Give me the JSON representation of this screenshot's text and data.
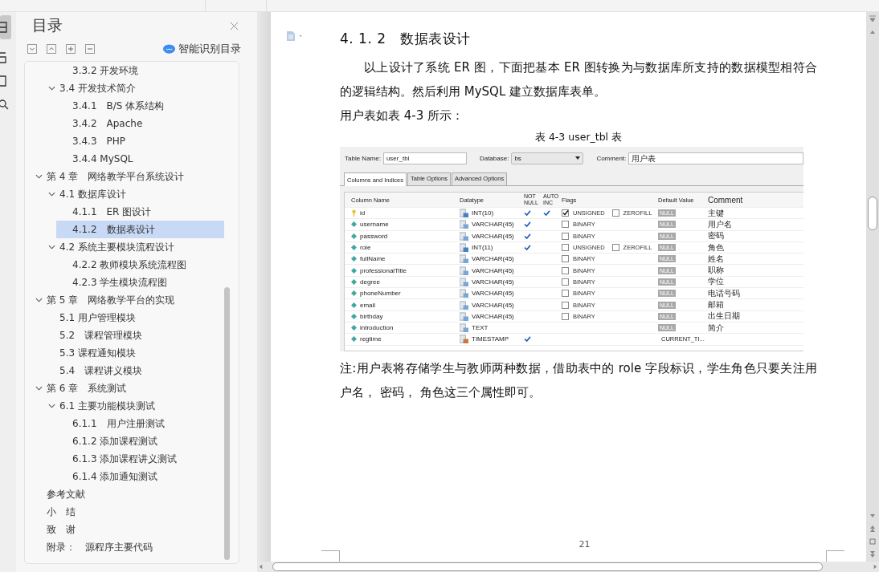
{
  "toc": {
    "title": "目录",
    "smart_button": "智能识别目录",
    "items": [
      {
        "children": [
          {
            "children": [
              {
                "label": "3.3.2 开发环境",
                "selected": false
              }
            ]
          },
          {
            "label": "3.4 开发技术简介",
            "expanded": true,
            "selected": false,
            "children": [
              {
                "label": "3.4.1　B/S 体系结构",
                "selected": false
              },
              {
                "label": "3.4.2　Apache",
                "selected": false
              },
              {
                "label": "3.4.3　PHP",
                "selected": false
              },
              {
                "label": "3.4.4 MySQL",
                "selected": false
              }
            ]
          }
        ]
      },
      {
        "label": "第 4 章　网络教学平台系统设计",
        "expanded": true,
        "selected": false,
        "children": [
          {
            "label": "4.1 数据库设计",
            "expanded": true,
            "selected": false,
            "children": [
              {
                "label": "4.1.1　ER 图设计",
                "selected": false
              },
              {
                "label": "4.1.2　数据表设计",
                "selected": true
              }
            ]
          },
          {
            "label": "4.2 系统主要模块流程设计",
            "expanded": true,
            "selected": false,
            "children": [
              {
                "label": "4.2.2 教师模块系统流程图",
                "selected": false
              },
              {
                "label": "4.2.3 学生模块流程图",
                "selected": false
              }
            ]
          }
        ]
      },
      {
        "label": "第 5 章　网络教学平台的实现",
        "expanded": true,
        "selected": false,
        "children": [
          {
            "label": "5.1 用户管理模块",
            "selected": false
          },
          {
            "label": "5.2　课程管理模块",
            "selected": false
          },
          {
            "label": "5.3 课程通知模块",
            "selected": false
          },
          {
            "label": "5.4　课程讲义模块",
            "selected": false
          }
        ]
      },
      {
        "label": "第 6 章　系统测试",
        "expanded": true,
        "selected": false,
        "children": [
          {
            "label": "6.1 主要功能模块测试",
            "expanded": true,
            "selected": false,
            "children": [
              {
                "label": "6.1.1　用户注册测试",
                "selected": false
              },
              {
                "label": "6.1.2 添加课程测试",
                "selected": false
              },
              {
                "label": "6.1.3 添加课程讲义测试",
                "selected": false
              },
              {
                "label": "6.1.4 添加通知测试",
                "selected": false
              }
            ]
          }
        ]
      },
      {
        "label": "参考文献",
        "selected": false
      },
      {
        "label": "小　结",
        "selected": false
      },
      {
        "label": "致　谢",
        "selected": false
      },
      {
        "label": "附录：　源程序主要代码",
        "selected": false
      }
    ]
  },
  "document": {
    "heading": "4. 1. 2　数据表设计",
    "paragraph": "以上设计了系统 ER 图，下面把基本 ER 图转换为与数据库所支持的数据模型相符合的逻辑结构。然后利用 MySQL 建立数据库表单。",
    "intro": "用户表如表 4-3 所示：",
    "caption": "表 4-3 user_tbl 表",
    "note": "注:用户表将存储学生与教师两种数据，借助表中的 role 字段标识，学生角色只要关注用户名， 密码， 角色这三个属性即可。",
    "page_number": "21"
  },
  "table_editor": {
    "table_name_label": "Table Name:",
    "table_name": "user_tbl",
    "database_label": "Database:",
    "database": "bs",
    "comment_label": "Comment:",
    "comment": "用户表",
    "tabs": [
      {
        "label": "Columns and Indices",
        "selected": true
      },
      {
        "label": "Table Options",
        "selected": false
      },
      {
        "label": "Advanced Options",
        "selected": false
      }
    ],
    "columns": [
      "Column Name",
      "Datatype",
      "NOT NULL",
      "AUTO INC",
      "Flags",
      "Default Value",
      "Comment"
    ],
    "rows": [
      {
        "name": "id",
        "primary_key": true,
        "datatype": "INT(10)",
        "kind": "int",
        "not_null": true,
        "auto_inc": true,
        "flags": [
          {
            "label": "UNSIGNED",
            "checked": true
          },
          {
            "label": "ZEROFILL",
            "checked": false
          }
        ],
        "default": "NULL",
        "comment": "主键"
      },
      {
        "name": "username",
        "primary_key": false,
        "datatype": "VARCHAR(45)",
        "kind": "varchar",
        "not_null": true,
        "auto_inc": false,
        "flags": [
          {
            "label": "BINARY",
            "checked": false
          }
        ],
        "default": "NULL",
        "comment": "用户名"
      },
      {
        "name": "password",
        "primary_key": false,
        "datatype": "VARCHAR(45)",
        "kind": "varchar",
        "not_null": true,
        "auto_inc": false,
        "flags": [
          {
            "label": "BINARY",
            "checked": false
          }
        ],
        "default": "NULL",
        "comment": "密码"
      },
      {
        "name": "role",
        "primary_key": false,
        "datatype": "INT(11)",
        "kind": "int",
        "not_null": true,
        "auto_inc": false,
        "flags": [
          {
            "label": "UNSIGNED",
            "checked": false
          },
          {
            "label": "ZEROFILL",
            "checked": false
          }
        ],
        "default": "NULL",
        "comment": "角色"
      },
      {
        "name": "fullName",
        "primary_key": false,
        "datatype": "VARCHAR(45)",
        "kind": "varchar",
        "not_null": false,
        "auto_inc": false,
        "flags": [
          {
            "label": "BINARY",
            "checked": false
          }
        ],
        "default": "NULL",
        "comment": "姓名"
      },
      {
        "name": "professionalTitle",
        "primary_key": false,
        "datatype": "VARCHAR(45)",
        "kind": "varchar",
        "not_null": false,
        "auto_inc": false,
        "flags": [
          {
            "label": "BINARY",
            "checked": false
          }
        ],
        "default": "NULL",
        "comment": "职称"
      },
      {
        "name": "degree",
        "primary_key": false,
        "datatype": "VARCHAR(45)",
        "kind": "varchar",
        "not_null": false,
        "auto_inc": false,
        "flags": [
          {
            "label": "BINARY",
            "checked": false
          }
        ],
        "default": "NULL",
        "comment": "学位"
      },
      {
        "name": "phoneNumber",
        "primary_key": false,
        "datatype": "VARCHAR(45)",
        "kind": "varchar",
        "not_null": false,
        "auto_inc": false,
        "flags": [
          {
            "label": "BINARY",
            "checked": false
          }
        ],
        "default": "NULL",
        "comment": "电话号码"
      },
      {
        "name": "email",
        "primary_key": false,
        "datatype": "VARCHAR(45)",
        "kind": "varchar",
        "not_null": false,
        "auto_inc": false,
        "flags": [
          {
            "label": "BINARY",
            "checked": false
          }
        ],
        "default": "NULL",
        "comment": "邮箱"
      },
      {
        "name": "birthday",
        "primary_key": false,
        "datatype": "VARCHAR(45)",
        "kind": "varchar",
        "not_null": false,
        "auto_inc": false,
        "flags": [
          {
            "label": "BINARY",
            "checked": false
          }
        ],
        "default": "NULL",
        "comment": "出生日期"
      },
      {
        "name": "introduction",
        "primary_key": false,
        "datatype": "TEXT",
        "kind": "varchar",
        "not_null": false,
        "auto_inc": false,
        "flags": [],
        "default": "NULL",
        "comment": "简介"
      },
      {
        "name": "regtime",
        "primary_key": false,
        "datatype": "TIMESTAMP",
        "kind": "timestamp",
        "not_null": true,
        "auto_inc": false,
        "flags": [],
        "default": "CURRENT_TI..."
      }
    ]
  }
}
